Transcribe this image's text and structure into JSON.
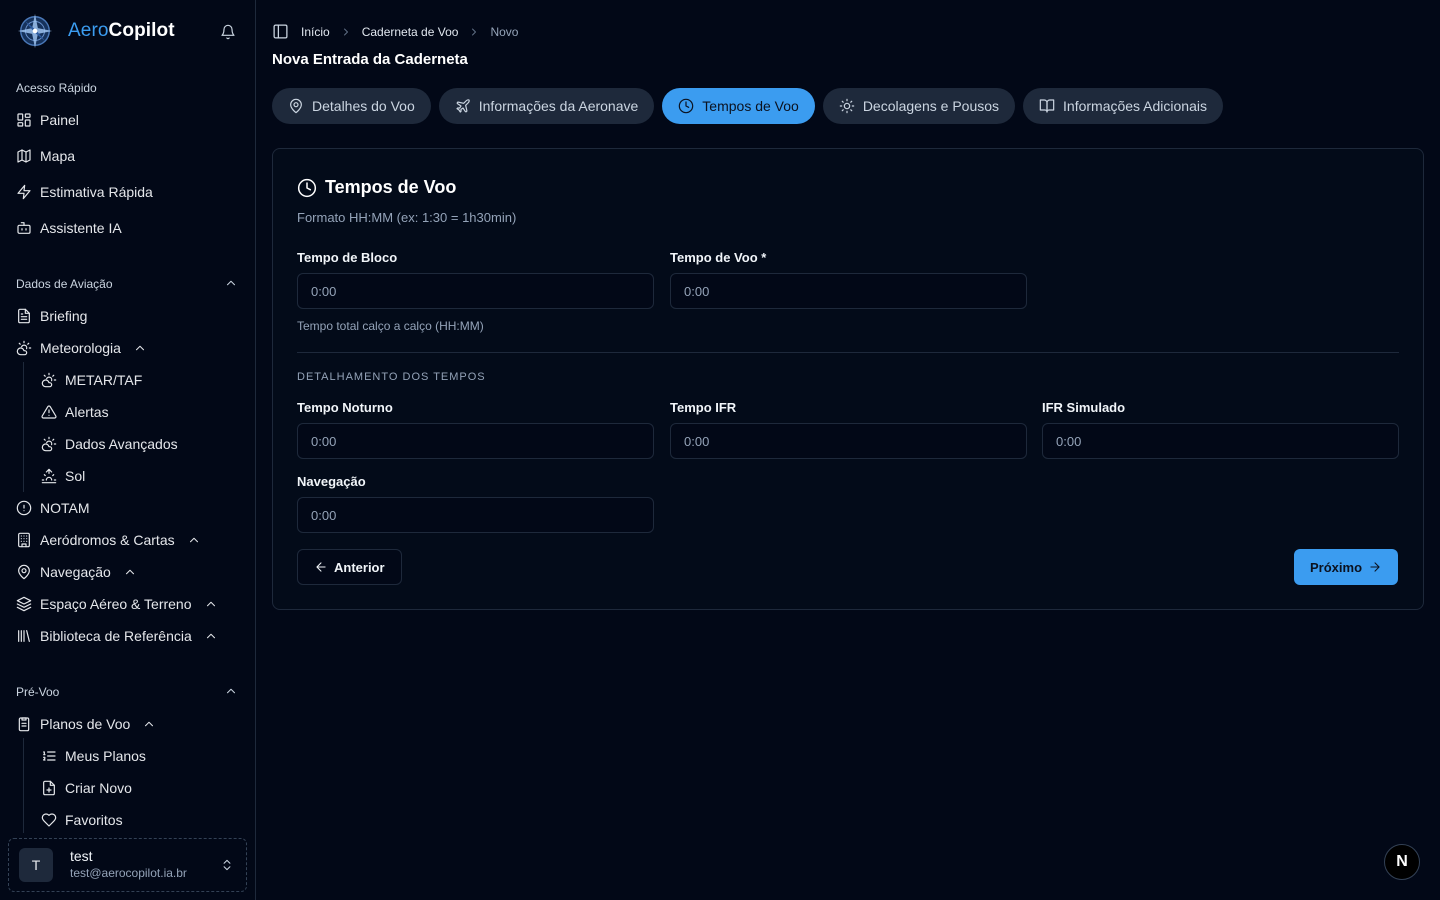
{
  "brand": {
    "part1": "Aero",
    "part2": "Copilot"
  },
  "sidebar": {
    "quick_access": {
      "label": "Acesso Rápido",
      "items": [
        "Painel",
        "Mapa",
        "Estimativa Rápida",
        "Assistente IA"
      ]
    },
    "aviation_data": {
      "label": "Dados de Aviação",
      "briefing": "Briefing",
      "meteorology": "Meteorologia",
      "meteorology_sub": [
        "METAR/TAF",
        "Alertas",
        "Dados Avançados",
        "Sol"
      ],
      "notam": "NOTAM",
      "aerodromes": "Aeródromos & Cartas",
      "navigation": "Navegação",
      "airspace": "Espaço Aéreo & Terreno",
      "library": "Biblioteca de Referência"
    },
    "preflight": {
      "label": "Pré-Voo",
      "flight_plans": "Planos de Voo",
      "flight_plans_sub": [
        "Meus Planos",
        "Criar Novo",
        "Favoritos"
      ]
    },
    "user": {
      "initial": "T",
      "name": "test",
      "email": "test@aerocopilot.ia.br"
    }
  },
  "breadcrumb": {
    "home": "Início",
    "logbook": "Caderneta de Voo",
    "current": "Novo"
  },
  "page_title": "Nova Entrada da Caderneta",
  "tabs": [
    {
      "label": "Detalhes do Voo",
      "icon": "map-pin-icon"
    },
    {
      "label": "Informações da Aeronave",
      "icon": "plane-icon"
    },
    {
      "label": "Tempos de Voo",
      "icon": "clock-icon",
      "active": true
    },
    {
      "label": "Decolagens e Pousos",
      "icon": "sun-icon"
    },
    {
      "label": "Informações Adicionais",
      "icon": "book-open-icon"
    }
  ],
  "card": {
    "title": "Tempos de Voo",
    "description": "Formato HH:MM (ex: 1:30 = 1h30min)",
    "block_time": {
      "label": "Tempo de Bloco",
      "placeholder": "0:00",
      "help": "Tempo total calço a calço (HH:MM)"
    },
    "flight_time": {
      "label": "Tempo de Voo *",
      "placeholder": "0:00"
    },
    "breakdown_heading": "DETALHAMENTO DOS TEMPOS",
    "night_time": {
      "label": "Tempo Noturno",
      "placeholder": "0:00"
    },
    "ifr_time": {
      "label": "Tempo IFR",
      "placeholder": "0:00"
    },
    "sim_ifr": {
      "label": "IFR Simulado",
      "placeholder": "0:00"
    },
    "navigation": {
      "label": "Navegação",
      "placeholder": "0:00"
    },
    "prev_label": "Anterior",
    "next_label": "Próximo"
  },
  "corner_badge": "N",
  "colors": {
    "accent": "#3b9cf0",
    "background": "#020817",
    "border": "#1e293b"
  }
}
